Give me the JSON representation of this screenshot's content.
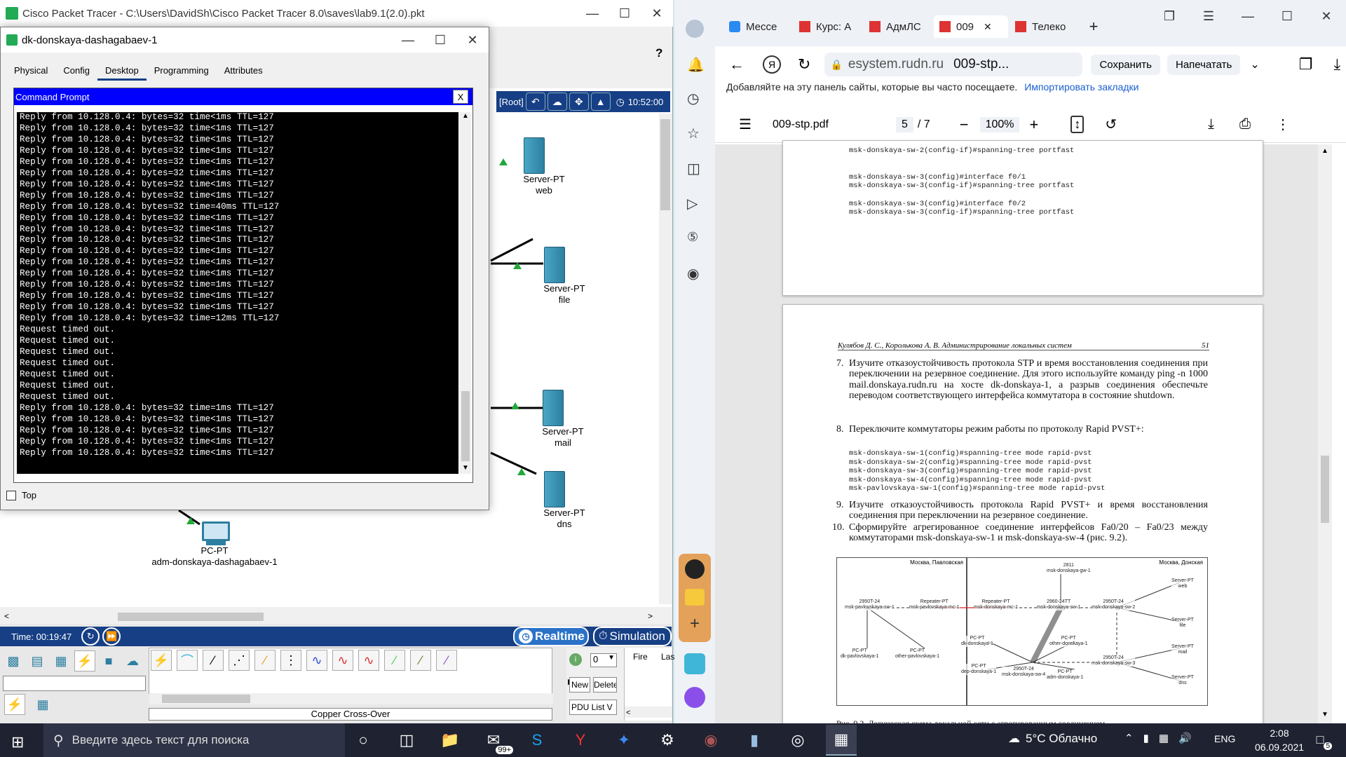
{
  "pt": {
    "title": "Cisco Packet Tracer - C:\\Users\\DavidSh\\Cisco Packet Tracer 8.0\\saves\\lab9.1(2.0).pkt",
    "help": "?",
    "status_root": "[Root]",
    "clock": "10:52:00",
    "devices": [
      {
        "type": "Server-PT",
        "name": "web"
      },
      {
        "type": "Server-PT",
        "name": "file"
      },
      {
        "type": "Server-PT",
        "name": "mail"
      },
      {
        "type": "Server-PT",
        "name": "dns"
      },
      {
        "type": "PC-PT",
        "name": "adm-donskaya-dashagabaev-1"
      }
    ],
    "time": "Time: 00:19:47",
    "realtime": "Realtime",
    "simulation": "Simulation",
    "cable_label": "Copper Cross-Over",
    "scenario_value": "0",
    "new_btn": "New",
    "delete_btn": "Delete",
    "pdu_btn": "PDU List V",
    "fire_col": "Fire",
    "last_col": "Las"
  },
  "dlg": {
    "title": "dk-donskaya-dashagabaev-1",
    "tabs": [
      "Physical",
      "Config",
      "Desktop",
      "Programming",
      "Attributes"
    ],
    "selected_tab": "Desktop",
    "cmd_title": "Command Prompt",
    "close": "X",
    "top_label": "Top",
    "terminal_lines": [
      "Reply from 10.128.0.4: bytes=32 time<1ms TTL=127",
      "Reply from 10.128.0.4: bytes=32 time<1ms TTL=127",
      "Reply from 10.128.0.4: bytes=32 time<1ms TTL=127",
      "Reply from 10.128.0.4: bytes=32 time<1ms TTL=127",
      "Reply from 10.128.0.4: bytes=32 time<1ms TTL=127",
      "Reply from 10.128.0.4: bytes=32 time<1ms TTL=127",
      "Reply from 10.128.0.4: bytes=32 time<1ms TTL=127",
      "Reply from 10.128.0.4: bytes=32 time<1ms TTL=127",
      "Reply from 10.128.0.4: bytes=32 time=40ms TTL=127",
      "Reply from 10.128.0.4: bytes=32 time<1ms TTL=127",
      "Reply from 10.128.0.4: bytes=32 time<1ms TTL=127",
      "Reply from 10.128.0.4: bytes=32 time<1ms TTL=127",
      "Reply from 10.128.0.4: bytes=32 time<1ms TTL=127",
      "Reply from 10.128.0.4: bytes=32 time<1ms TTL=127",
      "Reply from 10.128.0.4: bytes=32 time<1ms TTL=127",
      "Reply from 10.128.0.4: bytes=32 time=1ms TTL=127",
      "Reply from 10.128.0.4: bytes=32 time<1ms TTL=127",
      "Reply from 10.128.0.4: bytes=32 time<1ms TTL=127",
      "Reply from 10.128.0.4: bytes=32 time=12ms TTL=127",
      "Request timed out.",
      "Request timed out.",
      "Request timed out.",
      "Request timed out.",
      "Request timed out.",
      "Request timed out.",
      "Request timed out.",
      "Reply from 10.128.0.4: bytes=32 time=1ms TTL=127",
      "Reply from 10.128.0.4: bytes=32 time<1ms TTL=127",
      "Reply from 10.128.0.4: bytes=32 time<1ms TTL=127",
      "Reply from 10.128.0.4: bytes=32 time<1ms TTL=127",
      "Reply from 10.128.0.4: bytes=32 time<1ms TTL=127"
    ]
  },
  "browser": {
    "tabs": [
      {
        "label": "Мессе"
      },
      {
        "label": "Курс: А"
      },
      {
        "label": "АдмЛС"
      },
      {
        "label": "009",
        "active": true
      },
      {
        "label": "Телеко"
      }
    ],
    "url_domain": "esystem.rudn.ru",
    "page_title": "009-stp...",
    "save_btn": "Сохранить",
    "print_btn": "Напечатать",
    "bookmark_hint": "Добавляйте на эту панель сайты, которые вы часто посещаете.",
    "import_link": "Импортировать закладки",
    "pdf_name": "009-stp.pdf",
    "page_num": "5",
    "page_total": "/ 7",
    "zoom": "100%",
    "page1_lines": [
      "msk-donskaya-sw-2(config-if)#spanning-tree portfast",
      "",
      "",
      "msk-donskaya-sw-3(config)#interface f0/1",
      "msk-donskaya-sw-3(config-if)#spanning-tree portfast",
      "",
      "msk-donskaya-sw-3(config)#interface f0/2",
      "msk-donskaya-sw-3(config-if)#spanning-tree portfast"
    ],
    "page2_header": "Кулябов Д. С., Королькова А. В. Администрирование локальных систем",
    "page2_number": "51",
    "item7_num": "7.",
    "item7_text": "Изучите отказоустойчивость протокола STP и время восстановления соединения при переключении на резервное соединение. Для этого используйте команду ping -n 1000 mail.donskaya.rudn.ru на хосте dk-donskaya-1, а разрыв соединения обеспечьте переводом соответствующего интерфейса коммутатора в состояние shutdown.",
    "item8_num": "8.",
    "item8_text": "Переключите коммутаторы режим работы по протоколу Rapid PVST+:",
    "rapid_lines": [
      "msk-donskaya-sw-1(config)#spanning-tree mode rapid-pvst",
      "msk-donskaya-sw-2(config)#spanning-tree mode rapid-pvst",
      "msk-donskaya-sw-3(config)#spanning-tree mode rapid-pvst",
      "msk-donskaya-sw-4(config)#spanning-tree mode rapid-pvst",
      "msk-pavlovskaya-sw-1(config)#spanning-tree mode rapid-pvst"
    ],
    "item9_num": "9.",
    "item9_text": "Изучите отказоустойчивость протокола Rapid PVST+ и время восстановления соединения при переключении на резервное соединение.",
    "item10_num": "10.",
    "item10_text": "Сформируйте агрегированное соединение интерфейсов Fa0/20 – Fa0/23 между коммутаторами msk-donskaya-sw-1 и msk-donskaya-sw-4 (рис. 9.2).",
    "fig_left_title": "Москва, Павловская",
    "fig_right_title": "Москва, Донская",
    "fig_labels": [
      "2811\nmsk-donskaya-gw-1",
      "2950T-24\nmsk-pavlovskaya-sw-1",
      "Repeater-PT\nmsk-pavlovskaya-mc-1",
      "Repeater-PT\nmsk-donskaya-mc-1",
      "2960-24TT\nmsk-donskaya-sw-1",
      "2950T-24\nmsk-donskaya-sw-2",
      "Server-PT\nweb",
      "Server-PT\nfile",
      "Server-PT\nmail",
      "Server-PT\ndns",
      "PC-PT\ndk-pavlovskaya-1",
      "PC-PT\nother-pavlovskaya-1",
      "PC-PT\ndk-donskaya-1",
      "PC-PT\nother-donskaya-1",
      "PC-PT\ndep-donskaya-1",
      "2950T-24\nmsk-donskaya-sw-4",
      "PC-PT\nadm-donskaya-1",
      "2950T-24\nmsk-donskaya-sw-3"
    ],
    "caption": "Рис. 9.2. Логическая схема локальной сети с агрегированным соединением"
  },
  "taskbar": {
    "search_placeholder": "Введите здесь текст для поиска",
    "mail_badge": "99+",
    "weather": "5°C  Облачно",
    "lang": "ENG",
    "time": "2:08",
    "date": "06.09.2021",
    "notif_count": "5"
  },
  "colors": {
    "pt_blue": "#163f85",
    "cmd_title": "#0000ff",
    "server": "#3b95b8",
    "link_active": "#22a83a"
  }
}
